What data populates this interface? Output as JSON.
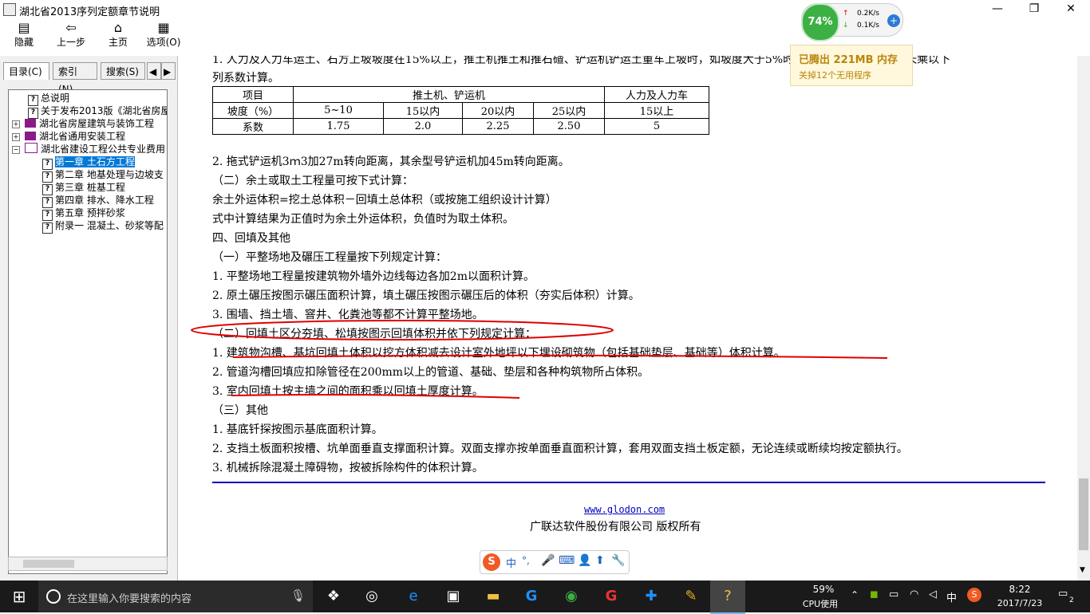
{
  "window": {
    "title": "湖北省2013序列定额章节说明",
    "minimize": "—",
    "maximize": "❐",
    "close": "✕"
  },
  "toolbar": {
    "hide": "隐藏",
    "back": "上一步",
    "home": "主页",
    "options": "选项(O)"
  },
  "tabs": {
    "toc": "目录(C)",
    "index": "索引(N)",
    "search": "搜索(S)",
    "prev": "◀",
    "next": "▶"
  },
  "tree": [
    {
      "label": "总说明"
    },
    {
      "label": "关于发布2013版《湖北省房屋"
    },
    {
      "label": "湖北省房屋建筑与装饰工程"
    },
    {
      "label": "湖北省通用安装工程"
    },
    {
      "label": "湖北省建设工程公共专业费用"
    },
    {
      "label": "第一章 土石方工程"
    },
    {
      "label": "第二章 地基处理与边坡支"
    },
    {
      "label": "第三章 桩基工程"
    },
    {
      "label": "第四章 排水、降水工程"
    },
    {
      "label": "第五章 预拌砂浆"
    },
    {
      "label": "附录一 混凝土、砂浆等配"
    }
  ],
  "content": {
    "line1": "1. 人力及人力车运土、石方上坡坡度在15%以上，推土机推土和推石碴、铲运机铲运土重车上坡时，如坡度大于5%时，其运距按坡度区段斜长乘以下",
    "line1b": "列系数计算。",
    "table": {
      "h_item": "项目",
      "h_machine": "推土机、铲运机",
      "h_manual": "人力及人力车",
      "r2_label": "坡度（%）",
      "r2": [
        "5~10",
        "15以内",
        "20以内",
        "25以内",
        "15以上"
      ],
      "r3_label": "系数",
      "r3": [
        "1.75",
        "2.0",
        "2.25",
        "2.50",
        "5"
      ]
    },
    "lines": [
      "2. 拖式铲运机3ｍ3加27m转向距离，其余型号铲运机加45m转向距离。",
      "（二）余土或取土工程量可按下式计算：",
      "余土外运体积=挖土总体积－回填土总体积（或按施工组织设计计算）",
      "式中计算结果为正值时为余土外运体积，负值时为取土体积。",
      "四、回填及其他",
      "（一）平整场地及碾压工程量按下列规定计算：",
      "1. 平整场地工程量按建筑物外墙外边线每边各加2m以面积计算。",
      "2. 原土碾压按图示碾压面积计算，填土碾压按图示碾压后的体积（夯实后体积）计算。",
      "3. 围墙、挡土墙、窨井、化粪池等都不计算平整场地。",
      "（二）回填土区分夯填、松填按图示回填体积并依下列规定计算：",
      "1. 建筑物沟槽、基坑回填土体积以挖方体积减去设计室外地坪以下埋设砌筑物（包括基础垫层、基础等）体积计算。",
      "2. 管道沟槽回填应扣除管径在200mm以上的管道、基础、垫层和各种构筑物所占体积。",
      "3. 室内回填土按主墙之间的面积乘以回填土厚度计算。",
      "（三）其他",
      "1. 基底钎探按图示基底面积计算。",
      "2. 支挡土板面积按槽、坑单面垂直支撑面积计算。双面支撑亦按单面垂直面积计算，套用双面支挡土板定额，无论连续或断续均按定额执行。",
      "3. 机械拆除混凝土障碍物，按被拆除构件的体积计算。"
    ],
    "footer_url": "www.glodon.com",
    "footer_company": "广联达软件股份有限公司 版权所有"
  },
  "popup": {
    "percent": "74%",
    "up": "0.2K/s",
    "down": "0.1K/s",
    "freed": "已腾出 221MB 内存",
    "closed": "关掉12个无用程序"
  },
  "ime": {
    "mode": "中"
  },
  "taskbar": {
    "search_placeholder": "在这里输入你要搜索的内容",
    "cpu_percent": "59%",
    "cpu_label": "CPU使用",
    "lang": "中",
    "time": "8:22",
    "date": "2017/7/23",
    "notifications": "2"
  }
}
